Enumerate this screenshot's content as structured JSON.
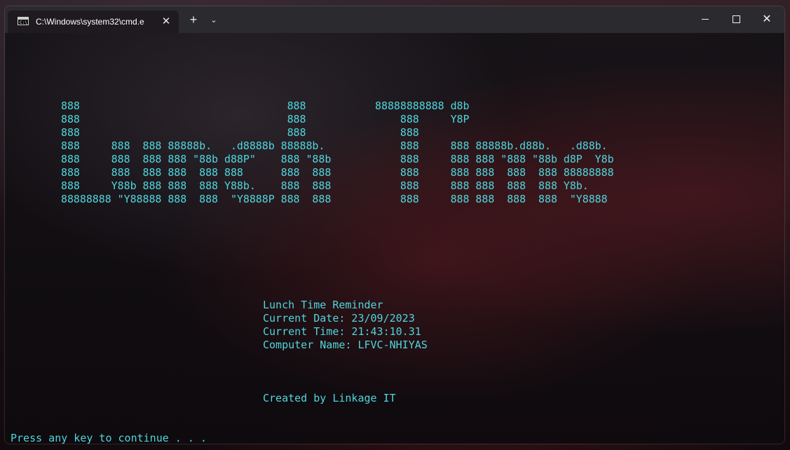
{
  "window": {
    "tab_title": "C:\\Windows\\system32\\cmd.e",
    "tab_icon": "cmd-icon",
    "close_tab_symbol": "✕",
    "new_tab_symbol": "+",
    "dropdown_symbol": "⌄",
    "close_window_symbol": "✕"
  },
  "console": {
    "banner_lines": [
      "888                                 888           88888888888 d8b",
      "888                                 888               888     Y8P",
      "888                                 888               888",
      "888     888  888 88888b.   .d8888b 88888b.            888     888 88888b.d88b.   .d88b.",
      "888     888  888 888 \"88b d88P\"    888 \"88b           888     888 888 \"888 \"88b d8P  Y8b",
      "888     888  888 888  888 888      888  888           888     888 888  888  888 88888888",
      "888     Y88b 888 888  888 Y88b.    888  888           888     888 888  888  888 Y8b.",
      "88888888 \"Y88888 888  888  \"Y8888P 888  888           888     888 888  888  888  \"Y8888"
    ],
    "reminder_title": "Lunch Time Reminder",
    "date_line": "Current Date: 23/09/2023",
    "time_line": "Current Time: 21:43:10.31",
    "computer_line": "Computer Name: LFVC-NHIYAS",
    "credit": "Created by Linkage IT",
    "prompt": "Press any key to continue . . ."
  },
  "colors": {
    "console_text": "#4fd6dd",
    "titlebar": "#2b2b2f",
    "tab_active": "#1e1a20"
  }
}
